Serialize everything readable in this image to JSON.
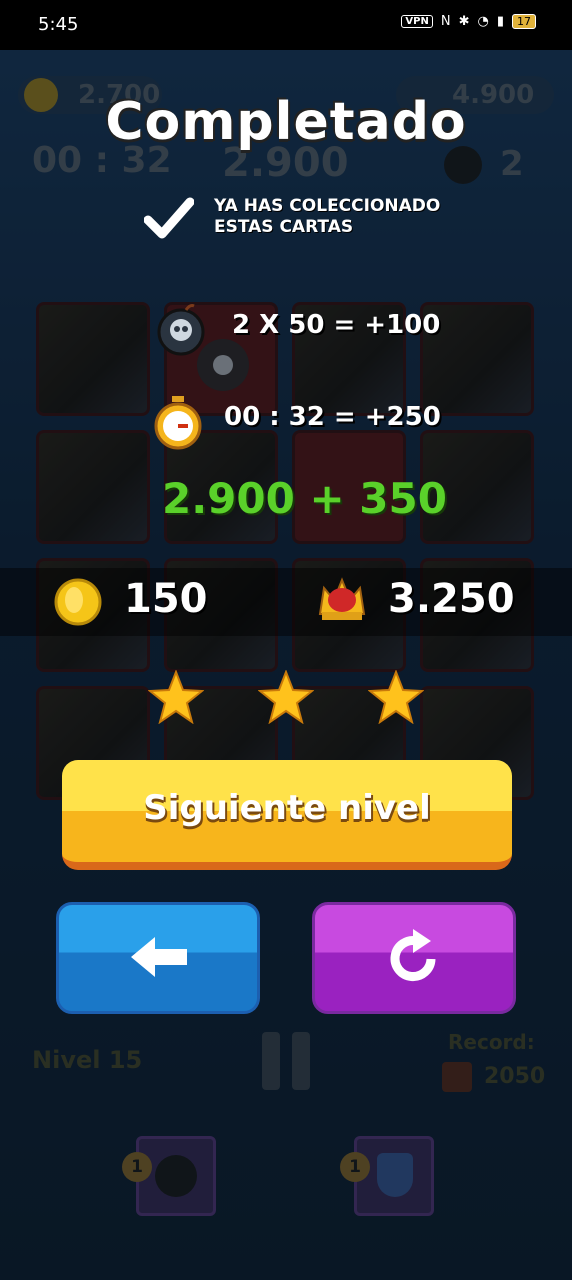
{
  "status": {
    "time": "5:45",
    "vpn": "VPN",
    "battery": "17"
  },
  "hud": {
    "coins": "2.700",
    "crown_score": "4.900",
    "timer": "00 : 32",
    "score": "2.900",
    "bombs": "2"
  },
  "result": {
    "title": "Completado",
    "collected_line1": "YA HAS COLECCIONADO",
    "collected_line2": "ESTAS CARTAS",
    "bomb_calc": "2 X 50 = +100",
    "time_calc": "00 : 32 = +250",
    "score_sum": "2.900 + 350",
    "coins_earned": "150",
    "total_score": "3.250",
    "stars": 3
  },
  "buttons": {
    "next_level": "Siguiente nivel"
  },
  "footer": {
    "level": "Nivel 15",
    "record_label": "Record:",
    "record_value": "2050"
  },
  "powerups": [
    {
      "count": "1",
      "icon": "bomb-icon"
    },
    {
      "count": "1",
      "icon": "shield-icon"
    }
  ],
  "colors": {
    "accent_green": "#5ad12a",
    "next_button": "#f7b51c",
    "back_button": "#1a78c8",
    "retry_button": "#9a22c0"
  }
}
